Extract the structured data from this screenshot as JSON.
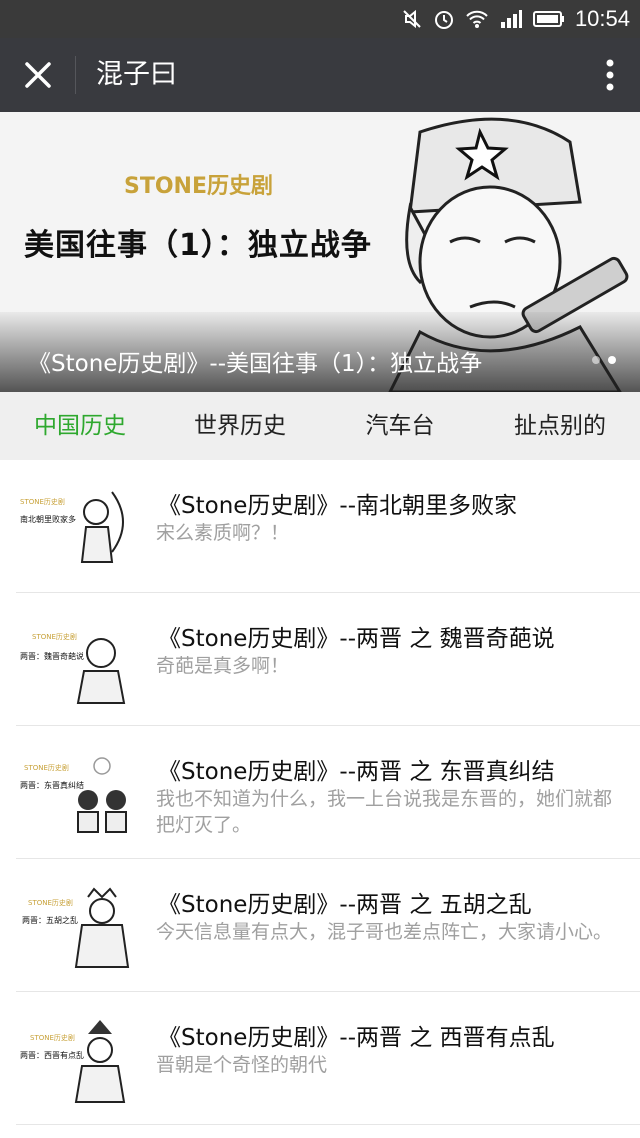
{
  "status_bar": {
    "time": "10:54",
    "icons": [
      "mute-icon",
      "alarm-icon",
      "wifi-icon",
      "signal-icon",
      "battery-icon"
    ]
  },
  "titlebar": {
    "title": "混子曰"
  },
  "banner": {
    "brand": "STONE历史剧",
    "headline": "美国往事（1）：独立战争",
    "caption": "《Stone历史剧》--美国往事（1）：独立战争",
    "pages": 2
  },
  "tabs": [
    {
      "label": "中国历史",
      "active": true
    },
    {
      "label": "世界历史",
      "active": false
    },
    {
      "label": "汽车台",
      "active": false
    },
    {
      "label": "扯点别的",
      "active": false
    }
  ],
  "articles": [
    {
      "title": "《Stone历史剧》--南北朝里多败家",
      "desc": "宋么素质啊？！",
      "thumb_text": "南北朝里败家多"
    },
    {
      "title": "《Stone历史剧》--两晋 之 魏晋奇葩说",
      "desc": "奇葩是真多啊！",
      "thumb_text": "两晋：魏晋奇葩说"
    },
    {
      "title": "《Stone历史剧》--两晋 之 东晋真纠结",
      "desc": "我也不知道为什么，我一上台说我是东晋的，她们就都把灯灭了。",
      "thumb_text": "两晋：东晋真纠结"
    },
    {
      "title": "《Stone历史剧》--两晋 之 五胡之乱",
      "desc": "今天信息量有点大，混子哥也差点阵亡，大家请小心。",
      "thumb_text": "两晋：五胡之乱"
    },
    {
      "title": "《Stone历史剧》--两晋 之 西晋有点乱",
      "desc": "晋朝是个奇怪的朝代",
      "thumb_text": "两晋：西晋有点乱"
    }
  ],
  "colors": {
    "accent": "#2ea82e",
    "titlebar": "#393a3f",
    "statusbar": "#3a3a3a",
    "brand": "#c8a23a"
  }
}
